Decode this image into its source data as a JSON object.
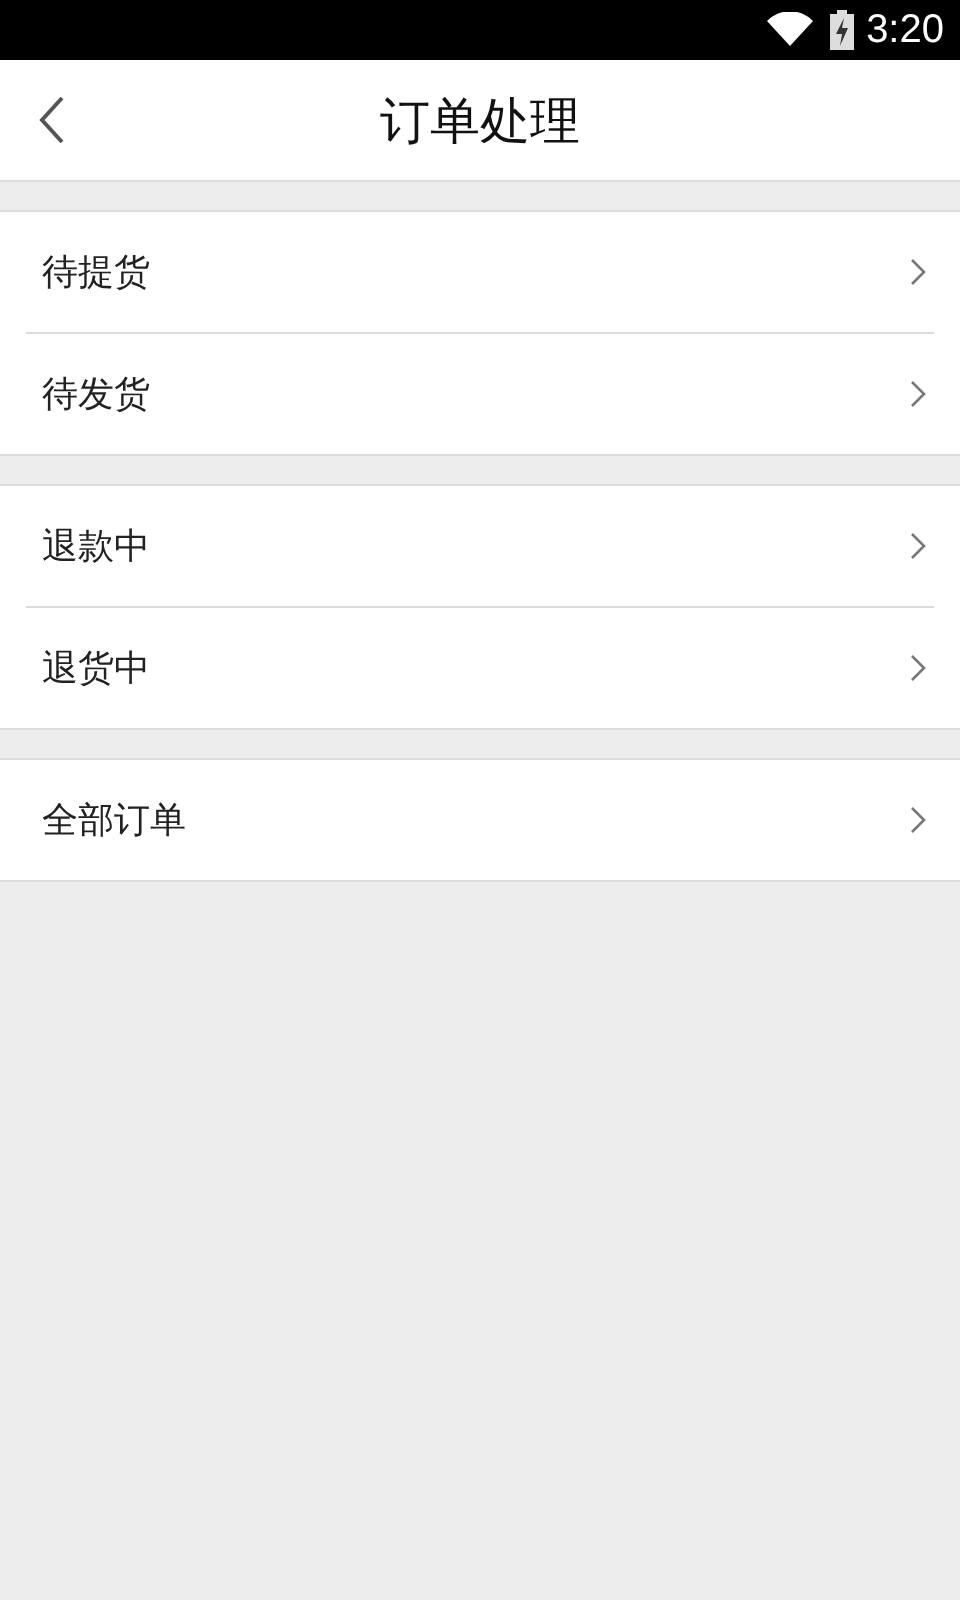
{
  "status_bar": {
    "time": "3:20"
  },
  "header": {
    "title": "订单处理"
  },
  "groups": [
    {
      "items": [
        {
          "label": "待提货"
        },
        {
          "label": "待发货"
        }
      ]
    },
    {
      "items": [
        {
          "label": "退款中"
        },
        {
          "label": "退货中"
        }
      ]
    },
    {
      "items": [
        {
          "label": "全部订单"
        }
      ]
    }
  ]
}
